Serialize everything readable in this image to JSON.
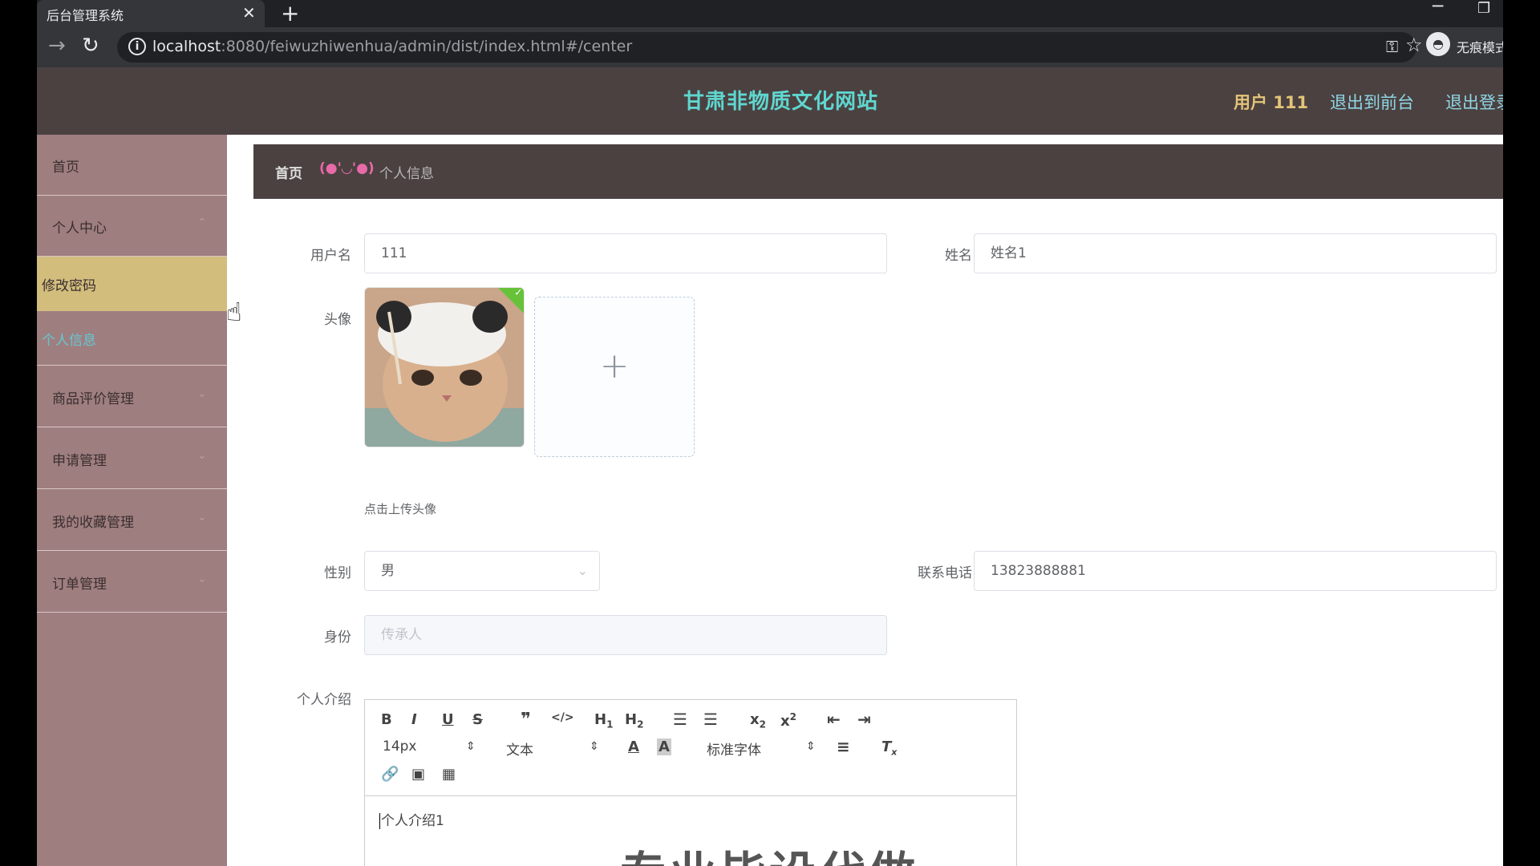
{
  "browser": {
    "tab_title": "后台管理系统",
    "tab_close": "✕",
    "new_tab": "+",
    "url_host": "localhost",
    "url_rest": ":8080/feiwuzhiwenhua/admin/dist/index.html#/center",
    "profile_label": "无痕模式"
  },
  "header": {
    "title": "甘肃非物质文化网站",
    "user": "用户 111",
    "to_front": "退出到前台",
    "logout": "退出登录"
  },
  "sidebar": {
    "items": [
      {
        "label": "首页"
      },
      {
        "label": "个人中心"
      },
      {
        "label": "修改密码"
      },
      {
        "label": "个人信息"
      },
      {
        "label": "商品评价管理"
      },
      {
        "label": "申请管理"
      },
      {
        "label": "我的收藏管理"
      },
      {
        "label": "订单管理"
      }
    ]
  },
  "breadcrumb": {
    "home": "首页",
    "separator": "(●'◡'●)",
    "current": "个人信息"
  },
  "form": {
    "username_label": "用户名",
    "username_value": "111",
    "name_label": "姓名",
    "name_value": "姓名1",
    "avatar_label": "头像",
    "upload_tip": "点击上传头像",
    "gender_label": "性别",
    "gender_value": "男",
    "phone_label": "联系电话",
    "phone_value": "13823888881",
    "role_label": "身份",
    "role_placeholder": "传承人",
    "intro_label": "个人介绍"
  },
  "editor": {
    "font_size": "14px",
    "paragraph": "文本",
    "font_family": "标准字体",
    "content": "个人介绍1",
    "watermark": "专业毕设代做"
  },
  "colors": {
    "header_bg": "#4b4141",
    "sidebar_bg": "#9f7e7f",
    "active_item": "#d2bd7d",
    "title_color": "#5fd7d0"
  }
}
